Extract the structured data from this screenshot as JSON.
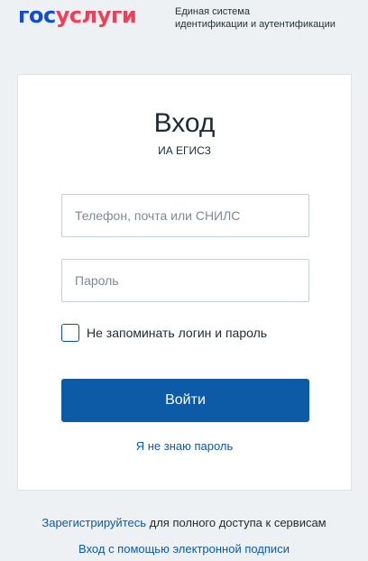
{
  "header": {
    "logo_part1": "гос",
    "logo_part2": "услуги",
    "subtitle_line1": "Единая система",
    "subtitle_line2": "идентификации и аутентификации"
  },
  "login": {
    "title": "Вход",
    "system_name": "ИА ЕГИСЗ",
    "login_placeholder": "Телефон, почта или СНИЛС",
    "password_placeholder": "Пароль",
    "remember_label": "Не запоминать логин и пароль",
    "remember_checked": false,
    "submit_label": "Войти",
    "forgot_label": "Я не знаю пароль"
  },
  "footer": {
    "register_link": "Зарегистрируйтесь",
    "register_suffix": " для полного доступа к сервисам",
    "signature_link": "Вход с помощью электронной подписи"
  },
  "colors": {
    "brand_blue": "#0d4cd3",
    "brand_red": "#ee3f58",
    "button": "#0d5aa7",
    "link": "#0d5aa7"
  }
}
